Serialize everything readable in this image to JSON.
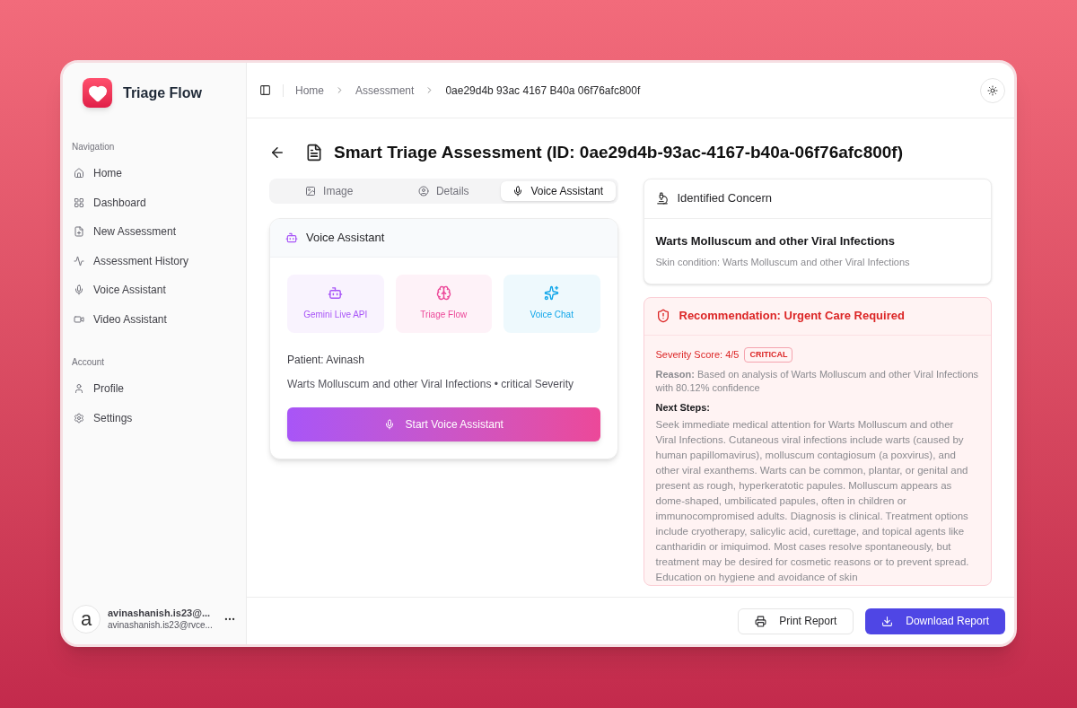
{
  "app": {
    "name": "Triage Flow"
  },
  "sidebar": {
    "sections": [
      {
        "title": "Navigation",
        "items": [
          {
            "label": "Home"
          },
          {
            "label": "Dashboard"
          },
          {
            "label": "New Assessment"
          },
          {
            "label": "Assessment History"
          },
          {
            "label": "Voice Assistant"
          },
          {
            "label": "Video Assistant"
          }
        ]
      },
      {
        "title": "Account",
        "items": [
          {
            "label": "Profile"
          },
          {
            "label": "Settings"
          }
        ]
      }
    ],
    "user": {
      "avatar": "a",
      "name": "avinashanish.is23@...",
      "email": "avinashanish.is23@rvce..."
    }
  },
  "breadcrumb": [
    "Home",
    "Assessment",
    "0ae29d4b 93ac 4167 B40a 06f76afc800f"
  ],
  "title": "Smart Triage Assessment (ID: 0ae29d4b-93ac-4167-b40a-06f76afc800f)",
  "tabs": [
    {
      "label": "Image",
      "selected": false
    },
    {
      "label": "Details",
      "selected": false
    },
    {
      "label": "Voice Assistant",
      "selected": true
    }
  ],
  "voice_card": {
    "title": "Voice Assistant",
    "features": [
      {
        "label": "Gemini Live API",
        "color": "#a855f7"
      },
      {
        "label": "Triage Flow",
        "color": "#ec4899"
      },
      {
        "label": "Voice Chat",
        "color": "#0ea5e9"
      }
    ],
    "patient": "Patient: Avinash",
    "summary": "Warts Molluscum and other Viral Infections • critical Severity",
    "button": "Start Voice Assistant"
  },
  "concern": {
    "title": "Identified Concern",
    "name": "Warts Molluscum and other Viral Infections",
    "detail": "Skin condition: Warts Molluscum and other Viral Infections"
  },
  "recommendation": {
    "title": "Recommendation: Urgent Care Required",
    "severity": "Severity Score: 4/5",
    "badge": "CRITICAL",
    "reason": "**Reason:** Based on analysis of Warts Molluscum and other Viral Infections with 80.12% confidence",
    "next_steps_label": "Next Steps:",
    "next_steps": "Seek immediate medical attention for Warts Molluscum and other Viral Infections. Cutaneous viral infections include warts (caused by human papillomavirus), molluscum contagiosum (a poxvirus), and other viral exanthems. Warts can be common, plantar, or genital and present as rough, hyperkeratotic papules. Molluscum appears as dome-shaped, umbilicated papules, often in children or immunocompromised adults. Diagnosis is clinical. Treatment options include cryotherapy, salicylic acid, curettage, and topical agents like cantharidin or imiquimod. Most cases resolve spontaneously, but treatment may be desired for cosmetic reasons or to prevent spread. Education on hygiene and avoidance of skin"
  },
  "footer": {
    "buttons": [
      "Print Report",
      "Download Report"
    ]
  }
}
